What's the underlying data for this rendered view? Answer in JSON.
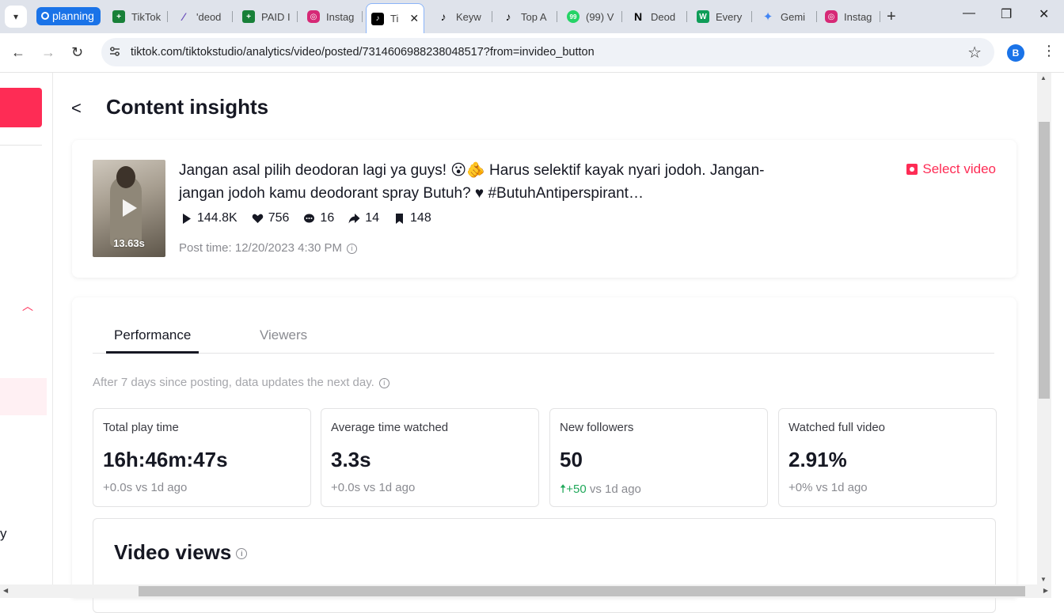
{
  "browser": {
    "group_label": "planning",
    "tabs": [
      {
        "label": "TikTok",
        "icon": "sheets-icon",
        "color": "#188038"
      },
      {
        "label": "'deod",
        "icon": "claude-icon",
        "color": "#6b4fbb"
      },
      {
        "label": "PAID I",
        "icon": "sheets-icon",
        "color": "#188038"
      },
      {
        "label": "Instag",
        "icon": "instagram-icon",
        "color": "#d62976"
      },
      {
        "label": "Ti",
        "icon": "tiktok-icon",
        "color": "#000000",
        "active": true
      },
      {
        "label": "Keyw",
        "icon": "tiktok-icon",
        "color": "#000000"
      },
      {
        "label": "Top A",
        "icon": "tiktok-icon",
        "color": "#000000"
      },
      {
        "label": "(99) V",
        "icon": "whatsapp-icon",
        "color": "#25d366"
      },
      {
        "label": "Deod",
        "icon": "notion-icon",
        "color": "#000000"
      },
      {
        "label": "Every",
        "icon": "w-icon",
        "color": "#0f9d58"
      },
      {
        "label": "Gemi",
        "icon": "gemini-icon",
        "color": "#4285f4"
      },
      {
        "label": "Instag",
        "icon": "instagram-icon",
        "color": "#d62976"
      }
    ],
    "url": "tiktok.com/tiktokstudio/analytics/video/posted/7314606988238048517?from=invideo_button",
    "profile_initial": "B"
  },
  "page": {
    "title": "Content insights",
    "rail_letter": "y"
  },
  "video": {
    "caption": "Jangan asal pilih deodoran lagi ya guys! 😮🫵 Harus selektif kayak nyari jodoh. Jangan-jangan jodoh kamu deodorant spray Butuh? ♥ #ButuhAntiperspirant…",
    "duration": "13.63s",
    "views": "144.8K",
    "likes": "756",
    "comments": "16",
    "shares": "14",
    "saves": "148",
    "post_time": "Post time: 12/20/2023 4:30 PM",
    "select_label": "Select video"
  },
  "performance": {
    "tabs": [
      "Performance",
      "Viewers"
    ],
    "note": "After 7 days since posting, data updates the next day.",
    "metrics": [
      {
        "label": "Total play time",
        "value": "16h:46m:47s",
        "delta": "+0.0s vs 1d ago"
      },
      {
        "label": "Average time watched",
        "value": "3.3s",
        "delta": "+0.0s vs 1d ago"
      },
      {
        "label": "New followers",
        "value": "50",
        "delta_up": "+50",
        "delta_rest": " vs 1d ago"
      },
      {
        "label": "Watched full video",
        "value": "2.91%",
        "delta": "+0% vs 1d ago"
      }
    ],
    "views_title": "Video views"
  },
  "colors": {
    "accent": "#fe2c55",
    "positive": "#20a85a"
  }
}
